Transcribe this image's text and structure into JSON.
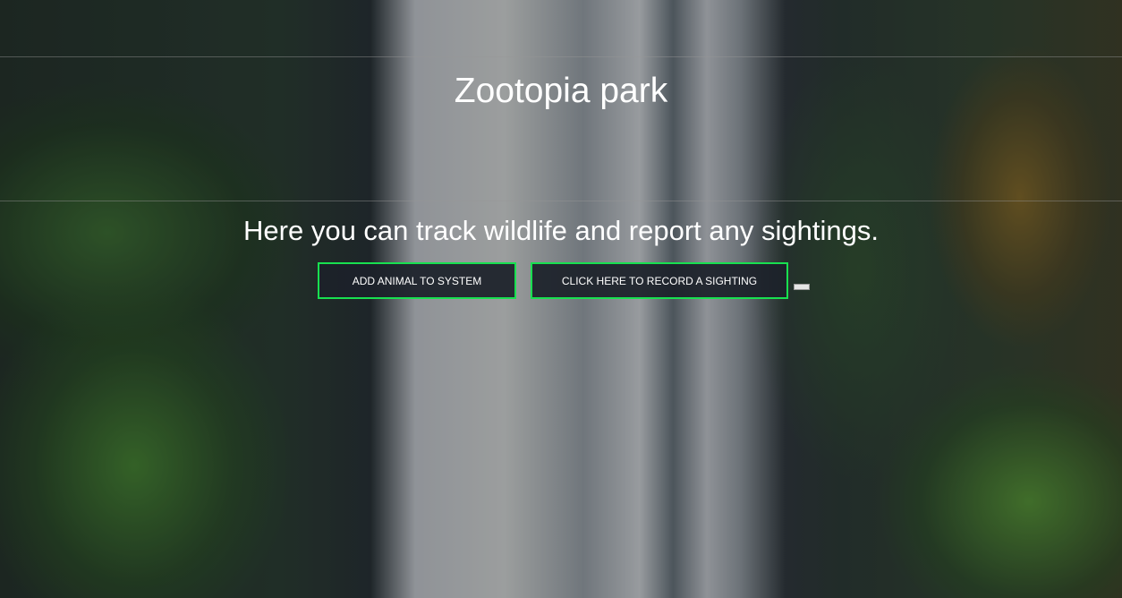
{
  "header": {
    "title": "Zootopia park",
    "subtitle": "Here you can track wildlife and report any sightings."
  },
  "actions": {
    "add_animal_label": "ADD ANIMAL TO SYSTEM",
    "record_sighting_label": "CLICK HERE TO RECORD A SIGHTING"
  },
  "colors": {
    "button_border": "#18e050",
    "button_bg": "#1c212a"
  }
}
